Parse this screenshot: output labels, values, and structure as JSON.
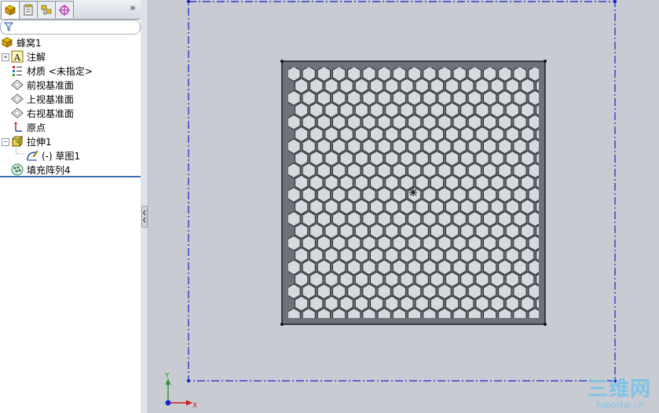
{
  "panel": {
    "more_label": "»",
    "tree": [
      {
        "label": "蜂窝1",
        "icon": "part-icon"
      },
      {
        "label": "注解",
        "icon": "annotation-icon"
      },
      {
        "label": "材质 <未指定>",
        "icon": "material-icon"
      },
      {
        "label": "前视基准面",
        "icon": "plane-icon"
      },
      {
        "label": "上视基准面",
        "icon": "plane-icon"
      },
      {
        "label": "右视基准面",
        "icon": "plane-icon"
      },
      {
        "label": "原点",
        "icon": "origin-icon"
      },
      {
        "label": "拉伸1",
        "icon": "extrude-icon"
      },
      {
        "label": "(-) 草图1",
        "icon": "sketch-icon"
      },
      {
        "label": "填充阵列4",
        "icon": "fill-pattern-icon"
      }
    ]
  },
  "viewport": {
    "triad_x_label": "X",
    "triad_y_label": "Y",
    "watermark_main": "三维网",
    "watermark_sub": "3dportal.cn"
  },
  "colors": {
    "sketch_line": "#1a22c8",
    "plate": "#6e7179",
    "hole": "#d6d9de",
    "viewport_bg": "#c8cbd2"
  }
}
